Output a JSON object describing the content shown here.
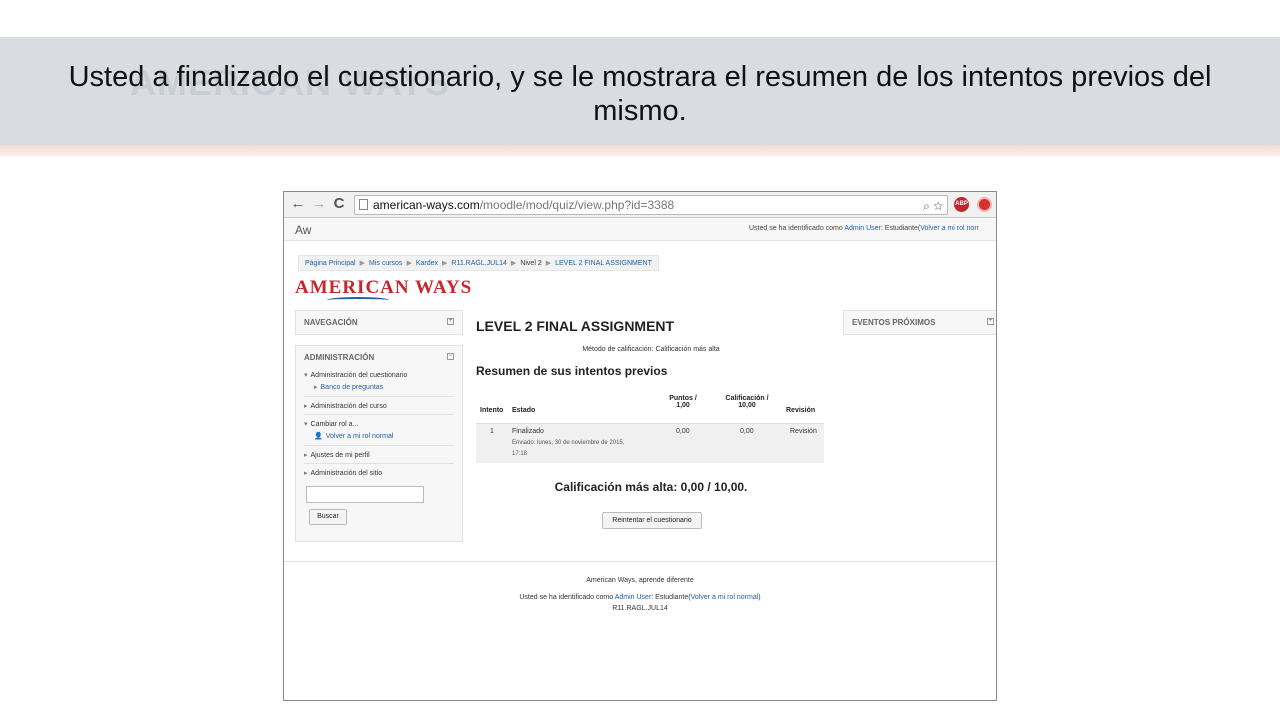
{
  "slide": {
    "title": "Usted a finalizado el cuestionario, y se le mostrara el resumen de los intentos previos del mismo.",
    "watermark_logo": "AMERICAN WAYS"
  },
  "browser": {
    "url_domain": "american-ways.com",
    "url_path": "/moodle/mod/quiz/view.php?id=3388",
    "back_icon": "←",
    "forward_icon": "→",
    "reload_icon": "C",
    "zoom_icon": "⌕",
    "star_icon": "☆",
    "abp_label": "ABP"
  },
  "topbar": {
    "brand": "Aw",
    "login_prefix": "Usted se ha identificado como ",
    "user": "Admin User",
    "login_role": ": Estudiante(",
    "return_link": "Volver a mi rol norr"
  },
  "breadcrumb": [
    "Página Principal",
    "Mis cursos",
    "Kardex",
    "R11.RAGL.JUL14",
    "Nivel 2",
    "LEVEL 2 FINAL ASSIGNMENT"
  ],
  "logo": "AMERICAN WAYS",
  "blocks": {
    "navigation": "NAVEGACIÓN",
    "administration": "ADMINISTRACIÓN",
    "events": "EVENTOS PRÓXIMOS",
    "toggle_minus": "−",
    "toggle_plus": "+"
  },
  "admin_tree": {
    "quiz_admin": "Administración del cuestionario",
    "question_bank": "Banco de preguntas",
    "course_admin": "Administración del curso",
    "switch_role": "Cambiar rol a...",
    "return_role": "Volver a mi rol normal",
    "profile_settings": "Ajustes de mi perfil",
    "site_admin": "Administración del sitio",
    "search_button": "Buscar"
  },
  "quiz": {
    "title": "LEVEL 2 FINAL ASSIGNMENT",
    "grading_method": "Método de calificación: Calificación más alta",
    "summary_heading": "Resumen de sus intentos previos",
    "headers": {
      "attempt": "Intento",
      "state": "Estado",
      "points_line1": "Puntos /",
      "points_line2": "1,00",
      "grade_line1": "Calificación /",
      "grade_line2": "10,00",
      "review": "Revisión"
    },
    "rows": [
      {
        "attempt": "1",
        "state": "Finalizado",
        "submitted_line1": "Enviado: lunes, 30 de noviembre de 2015,",
        "submitted_line2": "17:18",
        "points": "0,00",
        "grade": "0,00",
        "review": "Revisión"
      }
    ],
    "highest_grade": "Calificación más alta: 0,00 / 10,00.",
    "retry_button": "Reintentar el cuestionario"
  },
  "footer": {
    "tagline": "American Ways, aprende diferente",
    "login_prefix": "Usted se ha identificado como ",
    "user": "Admin User",
    "login_role": ": Estudiante(",
    "return_link": "Volver a mi rol normal",
    "close_paren": ")",
    "course_link": "R11.RAGL.JUL14"
  }
}
